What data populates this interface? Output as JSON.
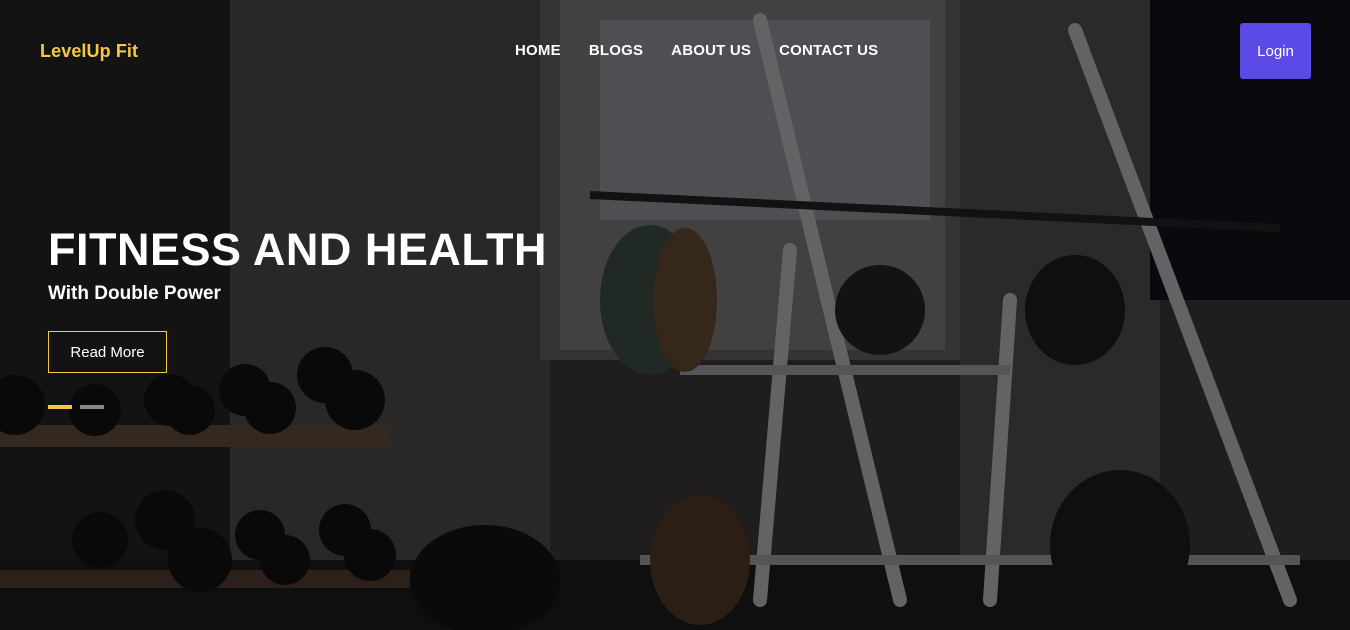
{
  "brand": {
    "name": "LevelUp Fit",
    "color": "#f5c842"
  },
  "nav": {
    "links": [
      {
        "label": "HOME"
      },
      {
        "label": "BLOGS"
      },
      {
        "label": "ABOUT US"
      },
      {
        "label": "CONTACT US"
      }
    ],
    "login_label": "Login",
    "login_color": "#5b4ae6"
  },
  "hero": {
    "title": "FITNESS AND HEALTH",
    "subtitle": "With Double Power",
    "cta_label": "Read More",
    "accent_color": "#f5c842",
    "slides_total": 2,
    "active_slide": 1,
    "background": "gym-weights-photo"
  }
}
